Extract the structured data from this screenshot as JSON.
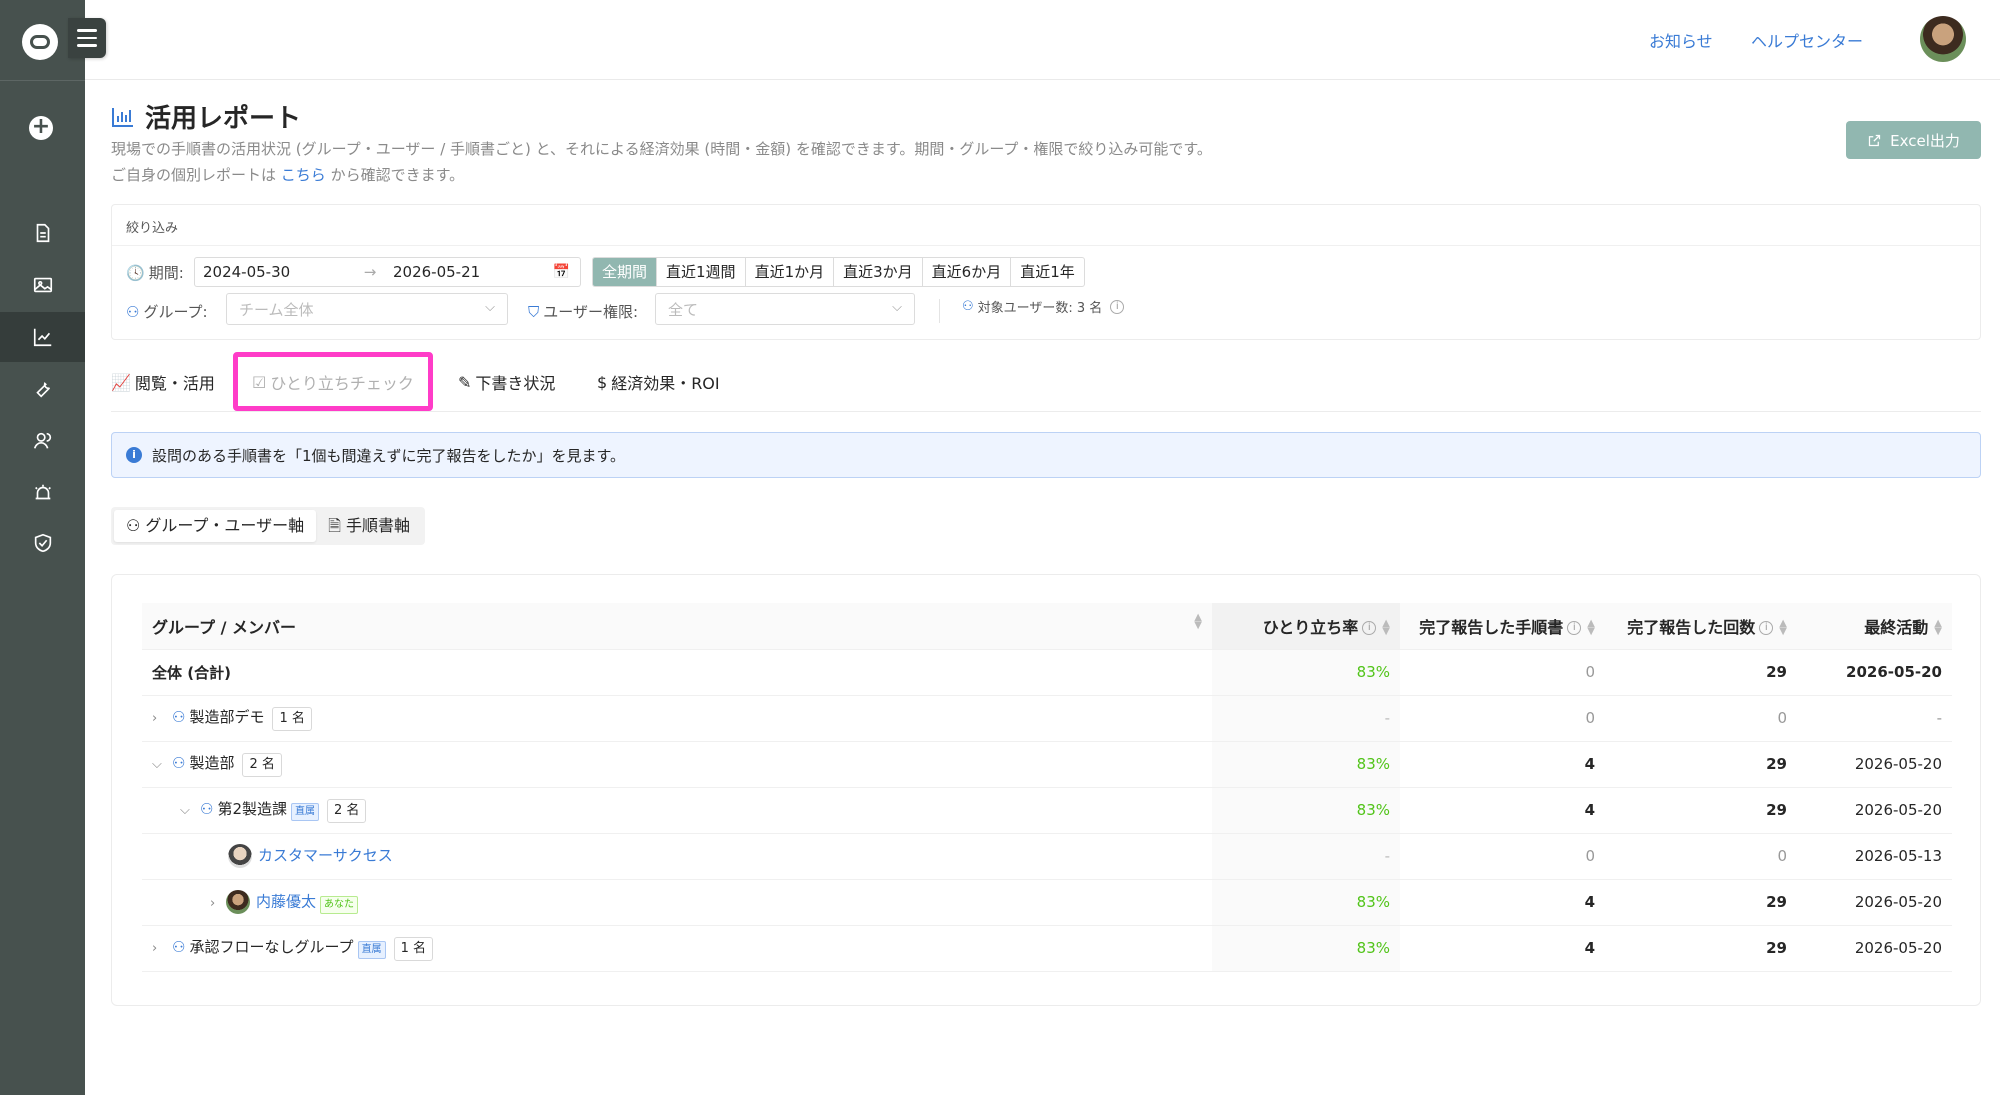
{
  "topbar": {
    "news": "お知らせ",
    "help": "ヘルプセンター"
  },
  "header": {
    "title": "活用レポート",
    "desc1": "現場での手順書の活用状況 (グループ・ユーザー / 手順書ごと) と、それによる経済効果 (時間・金額) を確認できます。期間・グループ・権限で絞り込み可能です。",
    "desc2_pre": "ご自身の個別レポートは",
    "desc2_link": "こちら",
    "desc2_post": "から確認できます。",
    "excel": "Excel出力"
  },
  "filter": {
    "title": "絞り込み",
    "period_label": "期間:",
    "date_from": "2024-05-30",
    "date_to": "2026-05-21",
    "ranges": [
      "全期間",
      "直近1週間",
      "直近1か月",
      "直近3か月",
      "直近6か月",
      "直近1年"
    ],
    "group_label": "グループ:",
    "group_placeholder": "チーム全体",
    "role_label": "ユーザー権限:",
    "role_placeholder": "全て",
    "user_count": "対象ユーザー数: 3 名"
  },
  "tabs": [
    "閲覧・活用",
    "ひとり立ちチェック",
    "下書き状況",
    "経済効果・ROI"
  ],
  "info": "設問のある手順書を「1個も間違えずに完了報告をしたか」を見ます。",
  "axis": [
    "グループ・ユーザー軸",
    "手順書軸"
  ],
  "table": {
    "headers": [
      "グループ / メンバー",
      "ひとり立ち率",
      "完了報告した手順書",
      "完了報告した回数",
      "最終活動"
    ],
    "total": {
      "name": "全体 (合計)",
      "rate": "83%",
      "docs": "0",
      "count": "29",
      "last": "2026-05-20"
    },
    "rows": [
      {
        "name": "製造部デモ",
        "count_tag": "1 名",
        "rate": "-",
        "docs": "0",
        "count": "0",
        "last": "-"
      },
      {
        "name": "製造部",
        "count_tag": "2 名",
        "rate": "83%",
        "docs": "4",
        "count": "29",
        "last": "2026-05-20"
      },
      {
        "name": "第2製造課",
        "badge": "直属",
        "count_tag": "2 名",
        "rate": "83%",
        "docs": "4",
        "count": "29",
        "last": "2026-05-20"
      },
      {
        "name": "カスタマーサクセス",
        "rate": "-",
        "docs": "0",
        "count": "0",
        "last": "2026-05-13"
      },
      {
        "name": "内藤優太",
        "badge": "あなた",
        "rate": "83%",
        "docs": "4",
        "count": "29",
        "last": "2026-05-20"
      },
      {
        "name": "承認フローなしグループ",
        "badge": "直属",
        "count_tag": "1 名",
        "rate": "83%",
        "docs": "4",
        "count": "29",
        "last": "2026-05-20"
      }
    ]
  },
  "colors": {
    "accent": "#91b7b0",
    "link": "#3a7bd5",
    "highlight": "#ff3cc8",
    "sidebar": "#47514e",
    "positive": "#52c41a"
  }
}
